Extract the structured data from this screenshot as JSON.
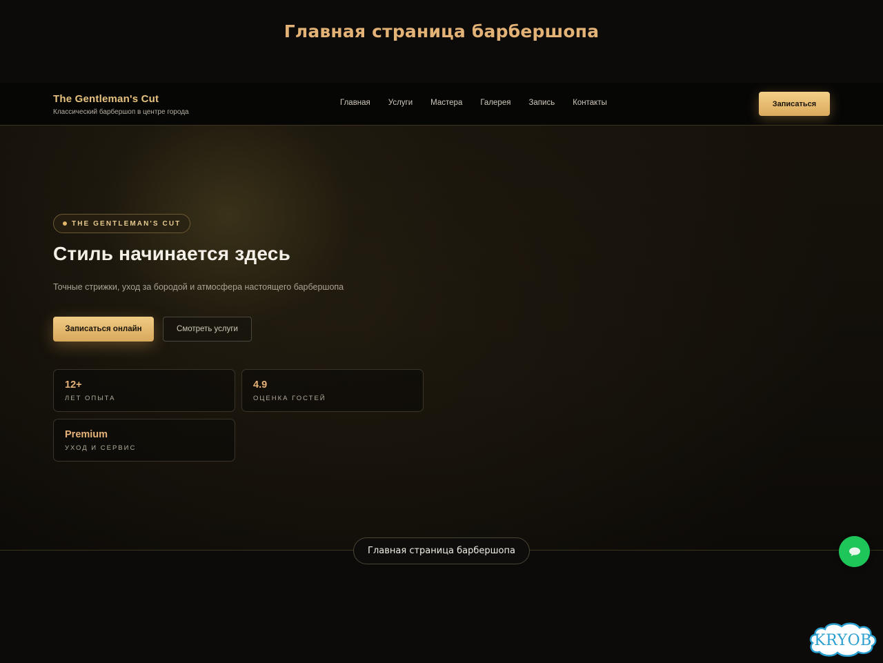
{
  "page": {
    "heading": "Главная страница барбершопа",
    "bottom_label": "Главная страница барбершопа"
  },
  "header": {
    "brand_name": "The Gentleman's Cut",
    "brand_tagline": "Классический барбершоп в центре города",
    "nav": [
      "Главная",
      "Услуги",
      "Мастера",
      "Галерея",
      "Запись",
      "Контакты"
    ],
    "cta_label": "Записаться"
  },
  "hero": {
    "eyebrow": "THE GENTLEMAN'S CUT",
    "title": "Стиль начинается здесь",
    "subtitle": "Точные стрижки, уход за бородой и атмосфера настоящего барбершопа",
    "primary_button": "Записаться онлайн",
    "secondary_button": "Смотреть услуги",
    "stats": [
      {
        "value": "12+",
        "label": "ЛЕТ ОПЫТА"
      },
      {
        "value": "4.9",
        "label": "ОЦЕНКА ГОСТЕЙ"
      },
      {
        "value": "Premium",
        "label": "УХОД И СЕРВИС"
      }
    ]
  },
  "widgets": {
    "chat_icon": "chat-bubble-icon",
    "watermark_text": "KRYOB"
  },
  "colors": {
    "accent_gold": "#e3b277",
    "button_gold": "#e6bb70",
    "chat_green": "#1ec65a",
    "background": "#0b0a08"
  }
}
